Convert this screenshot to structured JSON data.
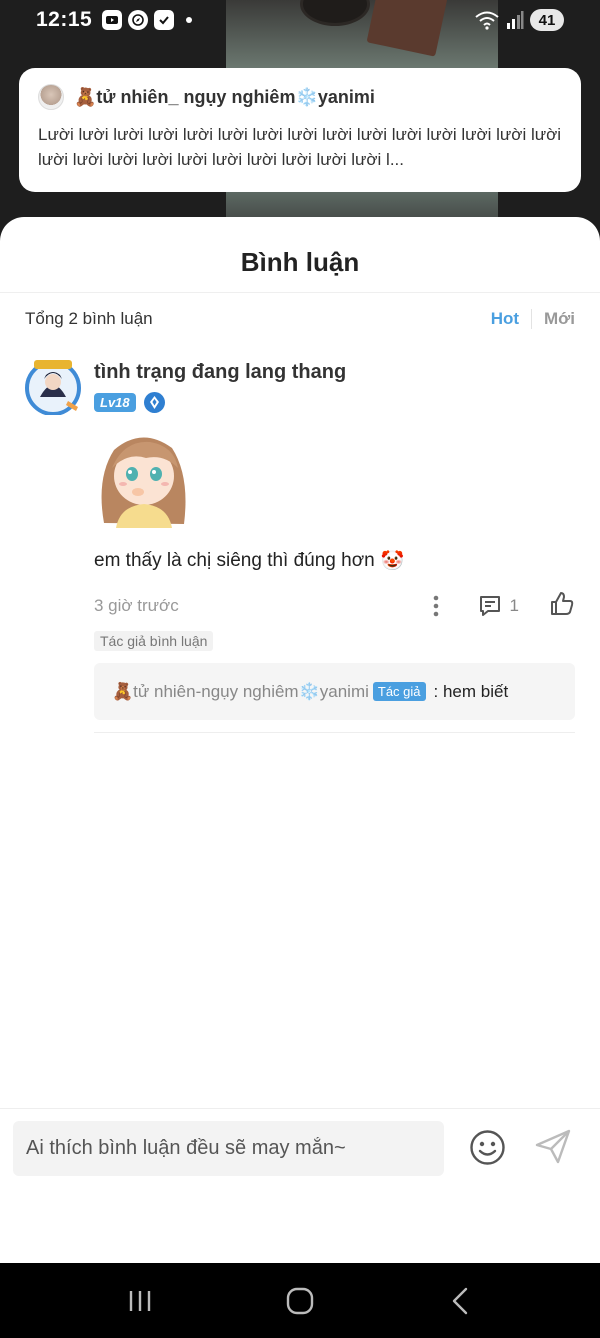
{
  "status_bar": {
    "time": "12:15",
    "battery": "41",
    "icons": [
      "youtube-icon",
      "compass-icon",
      "checkbox-icon",
      "dot-icon",
      "wifi-icon",
      "signal-icon"
    ]
  },
  "post": {
    "author_emoji_prefix": "🧸",
    "author": "🧸tử nhiên_ ngụy nghiêm❄️yanimi",
    "text": "Lười lười lười lười lười lười lười lười lười lười lười lười lười lười lười lười lười lười lười lười lười lười lười lười lười l..."
  },
  "comments_sheet": {
    "title": "Bình luận",
    "total": "Tổng 2 bình luận",
    "sort_tabs": [
      {
        "label": "Hot",
        "active": true
      },
      {
        "label": "Mới",
        "active": false
      }
    ],
    "comment": {
      "username": "tình trạng đang lang thang",
      "level": "Lv18",
      "text": "em thấy là chị siêng thì đúng hơn",
      "emoji": "🤡",
      "time": "3 giờ trước",
      "reply_count": "1",
      "author_tag": "Tác giả bình luận",
      "reply": {
        "author": "🧸tử nhiên-ngụy nghiêm❄️yanimi",
        "author_badge": "Tác giả",
        "text": ": hem biết"
      }
    }
  },
  "input": {
    "placeholder": "Ai thích bình luận đều sẽ may mắn~"
  },
  "colors": {
    "accent": "#4a9fe0",
    "muted": "#999999"
  }
}
